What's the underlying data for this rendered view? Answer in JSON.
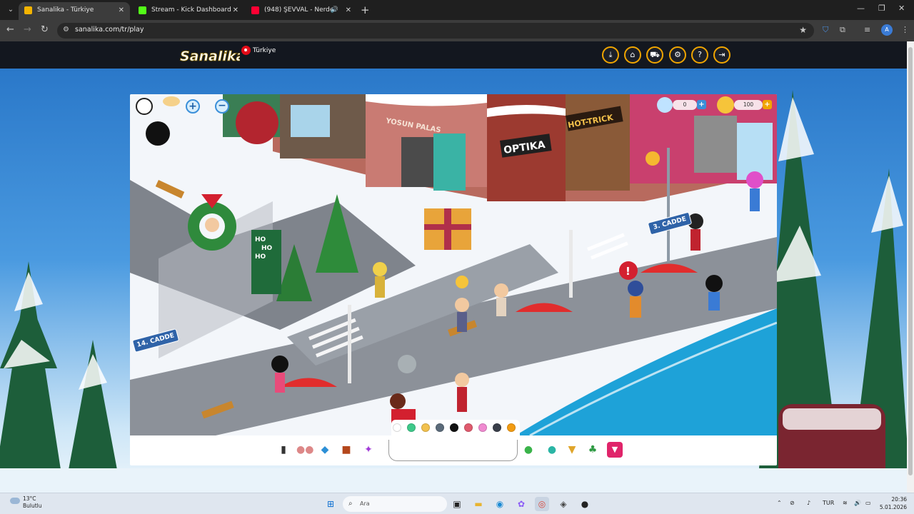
{
  "browser": {
    "tabs": [
      {
        "title": "Sanalika - Türkiye",
        "favicon_color": "#f4b400",
        "active": true
      },
      {
        "title": "Stream - Kick Dashboard",
        "favicon_color": "#53fc18",
        "active": false
      },
      {
        "title": "(948) ŞEVVAL - Nerdeydin (",
        "favicon_color": "#ff0033",
        "active": false
      }
    ],
    "url": "sanalika.com/tr/play",
    "profile_initial": "A"
  },
  "site": {
    "logo_text": "Sanalika",
    "language": "Türkiye",
    "header_buttons": [
      "download-icon",
      "home-icon",
      "cart-icon",
      "settings-icon",
      "help-icon",
      "logout-icon"
    ]
  },
  "game": {
    "diamonds": "0",
    "coins": "100",
    "street_signs": [
      "3. CADDE",
      "14. CADDE"
    ],
    "shop_signs": [
      "OPTIKA",
      "HOT-TRICK",
      "YOSUN PALAS"
    ],
    "colors": [
      "#ffffff",
      "#3ec98a",
      "#f2c14e",
      "#5b6b7a",
      "#111111",
      "#e05a6d",
      "#f08ad0",
      "#3a3f4a",
      "#f39c12"
    ],
    "tools_left": [
      "phone-icon",
      "footprints-icon",
      "fish-icon",
      "bag-icon",
      "dance-icon"
    ],
    "tools_right": [
      "chat-bubble-icon",
      "pet-icon",
      "trophy-icon",
      "island-icon",
      "menu-triangle-icon"
    ]
  },
  "taskbar": {
    "weather_temp": "13°C",
    "weather_desc": "Bulutlu",
    "search_placeholder": "Ara",
    "language": "TUR",
    "time": "20:36",
    "date": "5.01.2026"
  }
}
